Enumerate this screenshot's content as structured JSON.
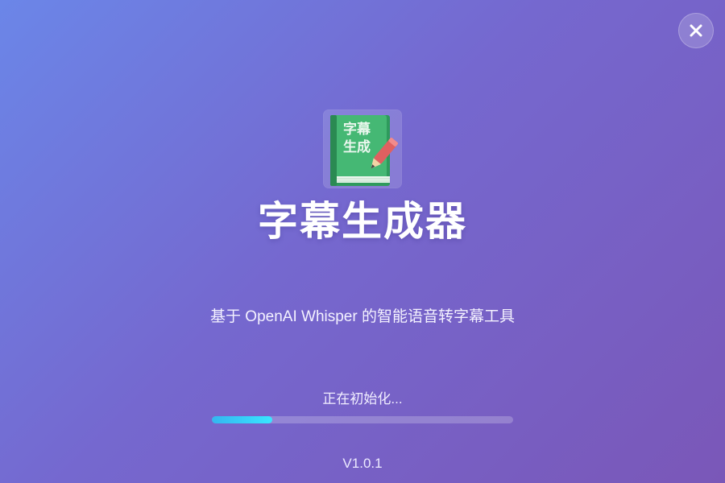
{
  "window": {
    "close_icon": "close-icon",
    "background_gradient": [
      "#6b86e8",
      "#7568cf",
      "#7a57b8"
    ]
  },
  "logo": {
    "icon": "book-pencil-icon",
    "line1": "字幕",
    "line2": "生成",
    "book_color": "#3cb371",
    "pencil_color": "#e06060"
  },
  "app": {
    "title": "字幕生成器",
    "subtitle": "基于 OpenAI Whisper 的智能语音转字幕工具"
  },
  "loading": {
    "status": "正在初始化...",
    "progress": 0.2,
    "bar_color": "#39e6ff"
  },
  "version": "V1.0.1"
}
